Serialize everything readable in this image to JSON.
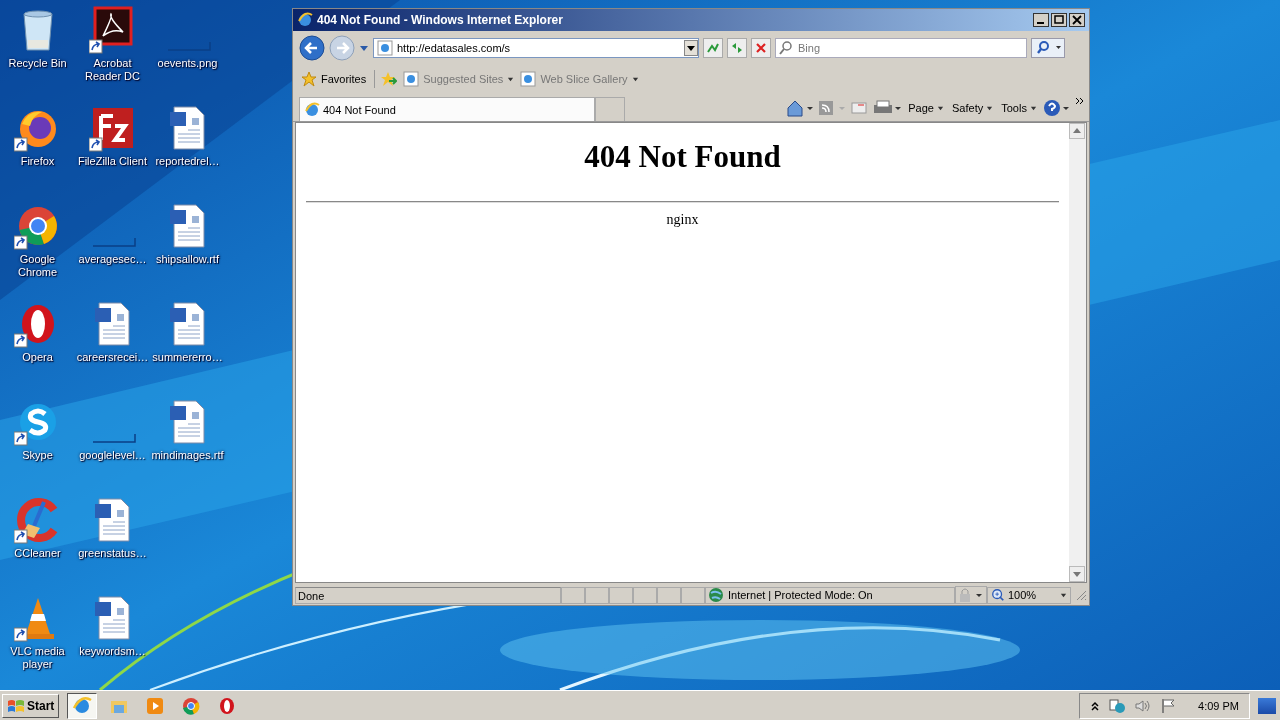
{
  "desktop_icons": [
    {
      "label": "Recycle Bin",
      "kind": "recycle",
      "shortcut": false
    },
    {
      "label": "Firefox",
      "kind": "firefox",
      "shortcut": true
    },
    {
      "label": "Google Chrome",
      "kind": "chrome",
      "shortcut": true
    },
    {
      "label": "Opera",
      "kind": "opera",
      "shortcut": true
    },
    {
      "label": "Skype",
      "kind": "skype",
      "shortcut": true
    },
    {
      "label": "CCleaner",
      "kind": "ccleaner",
      "shortcut": true
    },
    {
      "label": "VLC media player",
      "kind": "vlc",
      "shortcut": true
    },
    {
      "label": "Acrobat Reader DC",
      "kind": "acrobat",
      "shortcut": true
    },
    {
      "label": "FileZilla Client",
      "kind": "filezilla",
      "shortcut": true
    },
    {
      "label": "averagesec…",
      "kind": "blank",
      "shortcut": false
    },
    {
      "label": "careersrecei…",
      "kind": "document",
      "shortcut": false
    },
    {
      "label": "googlelevel…",
      "kind": "blank",
      "shortcut": false
    },
    {
      "label": "greenstatus…",
      "kind": "document",
      "shortcut": false
    },
    {
      "label": "keywordsm…",
      "kind": "document",
      "shortcut": false
    },
    {
      "label": "oevents.png",
      "kind": "blank",
      "shortcut": false
    },
    {
      "label": "reportedrel…",
      "kind": "document",
      "shortcut": false
    },
    {
      "label": "shipsallow.rtf",
      "kind": "document",
      "shortcut": false
    },
    {
      "label": "summererro…",
      "kind": "document",
      "shortcut": false
    },
    {
      "label": "mindimages.rtf",
      "kind": "document",
      "shortcut": false
    }
  ],
  "browser": {
    "title": "404 Not Found - Windows Internet Explorer",
    "address": "http://edatasales.com/s",
    "search": {
      "placeholder": "Bing"
    },
    "favorites": "Favorites",
    "favorites_links": [
      {
        "label": "Suggested Sites"
      },
      {
        "label": "Web Slice Gallery"
      }
    ],
    "tabs": [
      {
        "label": "404 Not Found",
        "selected": true
      }
    ],
    "command_menus": [
      "Page",
      "Safety",
      "Tools"
    ],
    "page": {
      "heading": "404 Not Found",
      "footer": "nginx"
    },
    "status_bar": {
      "text": "Done",
      "zone": "Internet | Protected Mode: On",
      "zoom": "100%"
    }
  },
  "taskbar": {
    "start": "Start",
    "pinned": [
      {
        "kind": "ie",
        "selected": true
      },
      {
        "kind": "folder",
        "selected": false
      },
      {
        "kind": "media",
        "selected": false
      },
      {
        "kind": "chrome",
        "selected": false
      },
      {
        "kind": "opera",
        "selected": false
      }
    ],
    "clock": "4:09 PM"
  }
}
